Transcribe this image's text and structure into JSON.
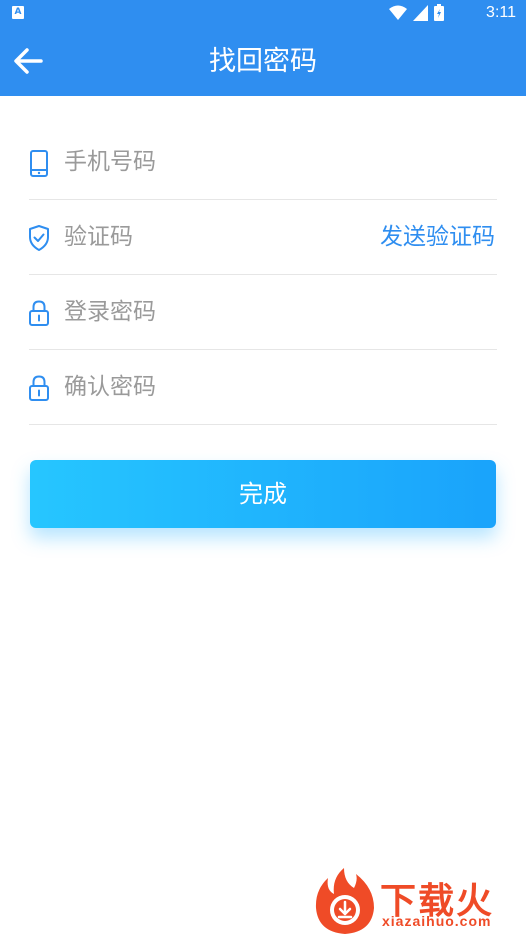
{
  "status_bar": {
    "left_icon_letter": "A",
    "time": "3:11",
    "icons": [
      "wifi-icon",
      "cell-signal-icon",
      "battery-icon"
    ]
  },
  "app_bar": {
    "title": "找回密码",
    "back_icon": "arrow-left-icon"
  },
  "form": {
    "phone": {
      "placeholder": "手机号码",
      "value": "",
      "icon": "phone-icon"
    },
    "code": {
      "placeholder": "验证码",
      "value": "",
      "icon": "shield-check-icon",
      "send_label": "发送验证码"
    },
    "password": {
      "placeholder": "登录密码",
      "value": "",
      "icon": "lock-icon"
    },
    "confirm_password": {
      "placeholder": "确认密码",
      "value": "",
      "icon": "lock-icon"
    }
  },
  "submit": {
    "label": "完成"
  },
  "watermark": {
    "text_cn": "下载火",
    "text_en": "xiazaihuo.com"
  },
  "colors": {
    "primary": "#2f8ef0",
    "button_gradient_start": "#26c6ff",
    "button_gradient_end": "#1aa3fb",
    "watermark": "#ef4b27"
  }
}
